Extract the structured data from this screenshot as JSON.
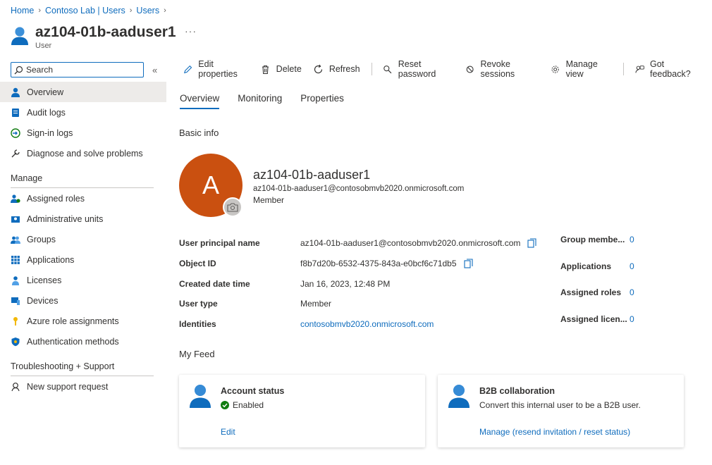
{
  "breadcrumb": [
    "Home",
    "Contoso Lab | Users",
    "Users"
  ],
  "header": {
    "title": "az104-01b-aaduser1",
    "subtitle": "User",
    "more": "···"
  },
  "sidebar": {
    "search_placeholder": "Search",
    "collapse": "«",
    "items": [
      {
        "label": "Overview",
        "icon": "user-icon"
      },
      {
        "label": "Audit logs",
        "icon": "audit-log-icon"
      },
      {
        "label": "Sign-in logs",
        "icon": "sign-in-icon"
      },
      {
        "label": "Diagnose and solve problems",
        "icon": "wrench-icon"
      }
    ],
    "manage_title": "Manage",
    "manage_items": [
      {
        "label": "Assigned roles",
        "icon": "roles-icon"
      },
      {
        "label": "Administrative units",
        "icon": "admin-units-icon"
      },
      {
        "label": "Groups",
        "icon": "groups-icon"
      },
      {
        "label": "Applications",
        "icon": "apps-grid-icon"
      },
      {
        "label": "Licenses",
        "icon": "license-icon"
      },
      {
        "label": "Devices",
        "icon": "device-icon"
      },
      {
        "label": "Azure role assignments",
        "icon": "key-icon"
      },
      {
        "label": "Authentication methods",
        "icon": "shield-icon"
      }
    ],
    "support_title": "Troubleshooting + Support",
    "support_items": [
      {
        "label": "New support request",
        "icon": "support-icon"
      }
    ]
  },
  "toolbar": {
    "edit": "Edit properties",
    "delete": "Delete",
    "refresh": "Refresh",
    "reset_password": "Reset password",
    "revoke": "Revoke sessions",
    "manage_view": "Manage view",
    "feedback": "Got feedback?"
  },
  "tabs": [
    "Overview",
    "Monitoring",
    "Properties"
  ],
  "basic_info": {
    "title": "Basic info",
    "avatar_letter": "A",
    "name": "az104-01b-aaduser1",
    "upn": "az104-01b-aaduser1@contosobmvb2020.onmicrosoft.com",
    "type": "Member"
  },
  "properties": [
    {
      "label": "User principal name",
      "value": "az104-01b-aaduser1@contosobmvb2020.onmicrosoft.com"
    },
    {
      "label": "Object ID",
      "value": "f8b7d20b-6532-4375-843a-e0bcf6c71db5"
    },
    {
      "label": "Created date time",
      "value": "Jan 16, 2023, 12:48 PM"
    },
    {
      "label": "User type",
      "value": "Member"
    },
    {
      "label": "Identities",
      "value": "contosobmvb2020.onmicrosoft.com"
    }
  ],
  "stats": [
    {
      "label": "Group membe...",
      "value": "0"
    },
    {
      "label": "Applications",
      "value": "0"
    },
    {
      "label": "Assigned roles",
      "value": "0"
    },
    {
      "label": "Assigned licen...",
      "value": "0"
    }
  ],
  "feed": {
    "title": "My Feed",
    "account": {
      "title": "Account status",
      "status": "Enabled",
      "link": "Edit"
    },
    "b2b": {
      "title": "B2B collaboration",
      "desc": "Convert this internal user to be a B2B user.",
      "link": "Manage (resend invitation / reset status)"
    }
  },
  "colors": {
    "accent": "#0f6cbd",
    "avatar": "#ca5010",
    "enabled": "#107c10"
  }
}
